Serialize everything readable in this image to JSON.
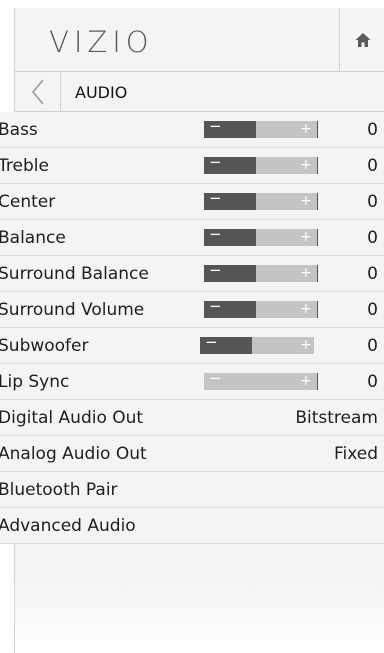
{
  "header": {
    "brand": "VIZIO",
    "home_icon": "home-icon"
  },
  "breadcrumb": {
    "back_icon": "back-arrow-icon",
    "title": "AUDIO"
  },
  "slider_rows": [
    {
      "label": "Bass",
      "value": "0",
      "fill": 0.5
    },
    {
      "label": "Treble",
      "value": "0",
      "fill": 0.5
    },
    {
      "label": "Center",
      "value": "0",
      "fill": 0.5
    },
    {
      "label": "Balance",
      "value": "0",
      "fill": 0.5
    },
    {
      "label": "Surround Balance",
      "value": "0",
      "fill": 0.5
    },
    {
      "label": "Surround Volume",
      "value": "0",
      "fill": 0.5
    },
    {
      "label": "Subwoofer",
      "value": "0",
      "fill": 0.5
    },
    {
      "label": "Lip Sync",
      "value": "0",
      "fill": 0.0
    }
  ],
  "option_rows": [
    {
      "label": "Digital Audio Out",
      "value": "Bitstream"
    },
    {
      "label": "Analog Audio Out",
      "value": "Fixed"
    },
    {
      "label": "Bluetooth Pair",
      "value": ""
    },
    {
      "label": "Advanced Audio",
      "value": ""
    }
  ],
  "colors": {
    "slider_dark": "#555555",
    "slider_light": "#c4c4c4",
    "panel_bg": "#f4f4f4"
  }
}
